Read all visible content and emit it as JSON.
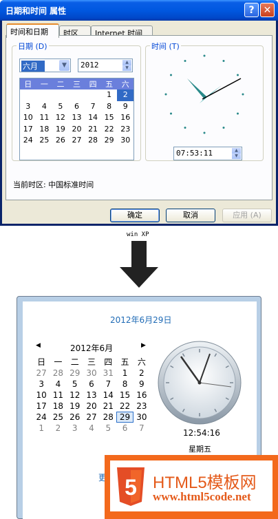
{
  "xp_window": {
    "title": "日期和时间 属性",
    "help_glyph": "?",
    "close_glyph": "✕",
    "tabs": [
      "时间和日期",
      "时区",
      "Internet 时间"
    ],
    "date_group_label": "日期 (D)",
    "time_group_label": "时间 (T)",
    "month_value": "六月",
    "year_value": "2012",
    "weekday_headers": [
      "日",
      "一",
      "二",
      "三",
      "四",
      "五",
      "六"
    ],
    "calendar_weeks": [
      [
        "",
        "",
        "",
        "",
        "",
        "1",
        "2"
      ],
      [
        "3",
        "4",
        "5",
        "6",
        "7",
        "8",
        "9"
      ],
      [
        "10",
        "11",
        "12",
        "13",
        "14",
        "15",
        "16"
      ],
      [
        "17",
        "18",
        "19",
        "20",
        "21",
        "22",
        "23"
      ],
      [
        "24",
        "25",
        "26",
        "27",
        "28",
        "29",
        "30"
      ]
    ],
    "selected_day": "2",
    "time_value": "07:53:11",
    "timezone_text": "当前时区: 中国标准时间",
    "ok_label": "确定",
    "cancel_label": "取消",
    "apply_label": "应用 (A)"
  },
  "arrow_label": "win XP",
  "win7_popup": {
    "date_link": "2012年6月29日",
    "prev_glyph": "◀",
    "next_glyph": "▶",
    "month_label": "2012年6月",
    "weekday_headers": [
      "日",
      "一",
      "二",
      "三",
      "四",
      "五",
      "六"
    ],
    "calendar_weeks": [
      [
        "27",
        "28",
        "29",
        "30",
        "31",
        "1",
        "2"
      ],
      [
        "3",
        "4",
        "5",
        "6",
        "7",
        "8",
        "9"
      ],
      [
        "10",
        "11",
        "12",
        "13",
        "14",
        "15",
        "16"
      ],
      [
        "17",
        "18",
        "19",
        "20",
        "21",
        "22",
        "23"
      ],
      [
        "24",
        "25",
        "26",
        "27",
        "28",
        "29",
        "30"
      ],
      [
        "1",
        "2",
        "3",
        "4",
        "5",
        "6",
        "7"
      ]
    ],
    "today": "29",
    "time_value": "12:54:16",
    "weekday_label": "星期五",
    "more_link": "更"
  },
  "watermark": {
    "badge": "5",
    "name": "HTML5模板网",
    "url": "www.html5code.net"
  },
  "colors": {
    "xp_title_blue": "#0058e0",
    "xp_face": "#ece9d8",
    "win7_link": "#1e6ab5",
    "watermark_orange": "#f3691c"
  }
}
